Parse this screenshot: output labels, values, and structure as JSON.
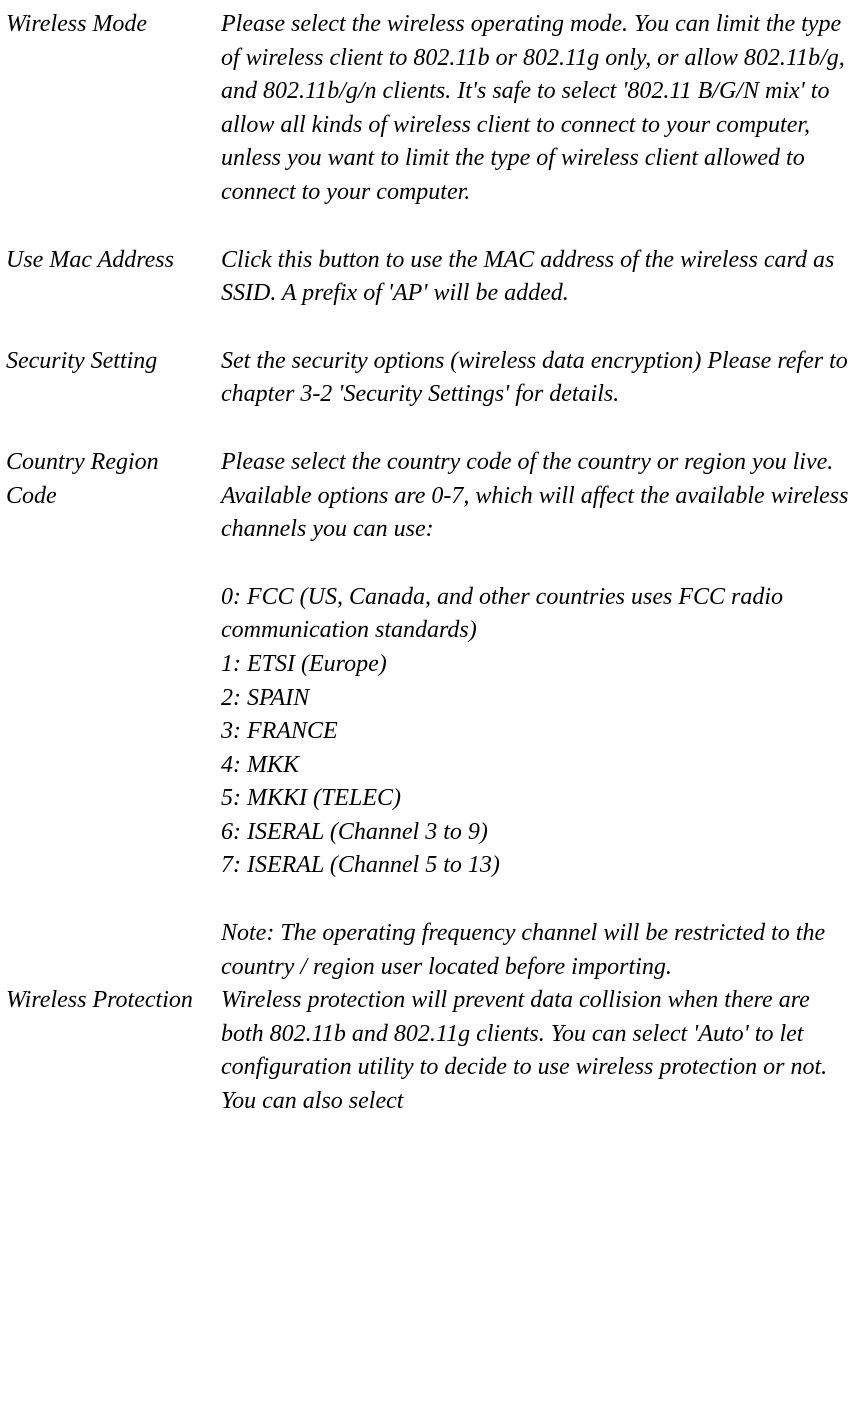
{
  "rows": [
    {
      "label": "Wireless Mode",
      "desc": "Please select the wireless operating mode. You can limit the type of wireless client to 802.11b or 802.11g only, or allow 802.11b/g, and 802.11b/g/n clients. It's safe to select '802.11 B/G/N mix' to allow all kinds of wireless client to connect to your computer, unless you want to limit the type of wireless client allowed to connect to your computer."
    },
    {
      "label": "Use Mac Address",
      "desc": "Click this button to use the MAC address of the wireless card as SSID. A prefix of 'AP' will be added."
    },
    {
      "label": "Security Setting",
      "desc": "Set the security options (wireless data encryption) Please refer to chapter 3-2 'Security Settings' for details."
    },
    {
      "label": "Country Region Code",
      "desc_intro": "Please select the country code of the country or region you live. Available options are 0-7, which will affect the available wireless channels you can use:",
      "codes": [
        "0: FCC (US, Canada, and other countries uses FCC radio communication standards)",
        "1: ETSI (Europe)",
        "2: SPAIN",
        "3: FRANCE",
        "4: MKK",
        "5: MKKI (TELEC)",
        "6: ISERAL (Channel 3 to 9)",
        "7: ISERAL (Channel 5 to 13)"
      ],
      "note": "Note: The operating frequency channel will be restricted to the country / region user located before importing."
    },
    {
      "label": "Wireless Protection",
      "desc": "Wireless protection will prevent data collision when there are both 802.11b and 802.11g clients. You can select 'Auto' to let configuration utility to decide to use wireless protection or not. You can also select"
    }
  ]
}
